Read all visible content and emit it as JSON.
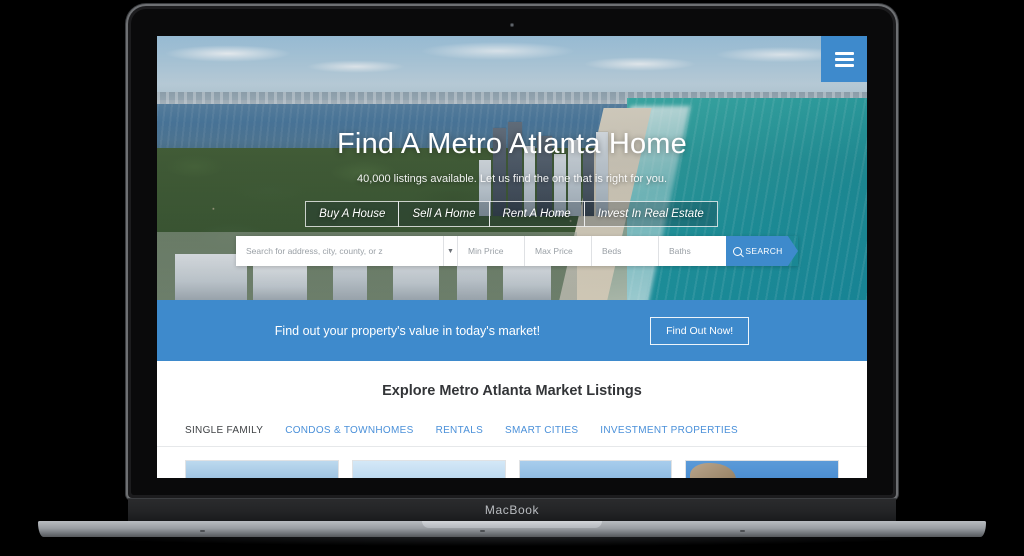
{
  "device": {
    "brand_label": "MacBook"
  },
  "site": {
    "menu_icon": "hamburger-icon",
    "hero": {
      "title": "Find A Metro Atlanta Home",
      "subtitle": "40,000 listings available. Let us find the one that is right for you.",
      "actions": [
        {
          "label": "Buy A House"
        },
        {
          "label": "Sell A Home"
        },
        {
          "label": "Rent A Home"
        },
        {
          "label": "Invest In Real Estate"
        }
      ]
    },
    "search": {
      "address_placeholder": "Search for address, city, county, or z",
      "dropdown_icon": "chevron-down-icon",
      "min_price_placeholder": "Min Price",
      "max_price_placeholder": "Max Price",
      "beds_placeholder": "Beds",
      "baths_placeholder": "Baths",
      "search_icon": "search-icon",
      "search_label": "SEARCH"
    },
    "cta": {
      "text": "Find out your property's value in today's market!",
      "button_label": "Find Out Now!"
    },
    "listings": {
      "heading": "Explore Metro Atlanta Market Listings",
      "tabs": [
        {
          "label": "SINGLE FAMILY",
          "active": true
        },
        {
          "label": "CONDOS & TOWNHOMES",
          "active": false
        },
        {
          "label": "RENTALS",
          "active": false
        },
        {
          "label": "SMART CITIES",
          "active": false
        },
        {
          "label": "INVESTMENT PROPERTIES",
          "active": false
        }
      ],
      "cards": [
        {
          "name": "property-thumbnail-1"
        },
        {
          "name": "property-thumbnail-2"
        },
        {
          "name": "property-thumbnail-3"
        },
        {
          "name": "property-thumbnail-4"
        }
      ]
    }
  },
  "colors": {
    "brand_blue": "#3e8acc",
    "tab_link_blue": "#4a90d9",
    "tab_active_gray": "#3f4245",
    "page_background": "#000000"
  }
}
